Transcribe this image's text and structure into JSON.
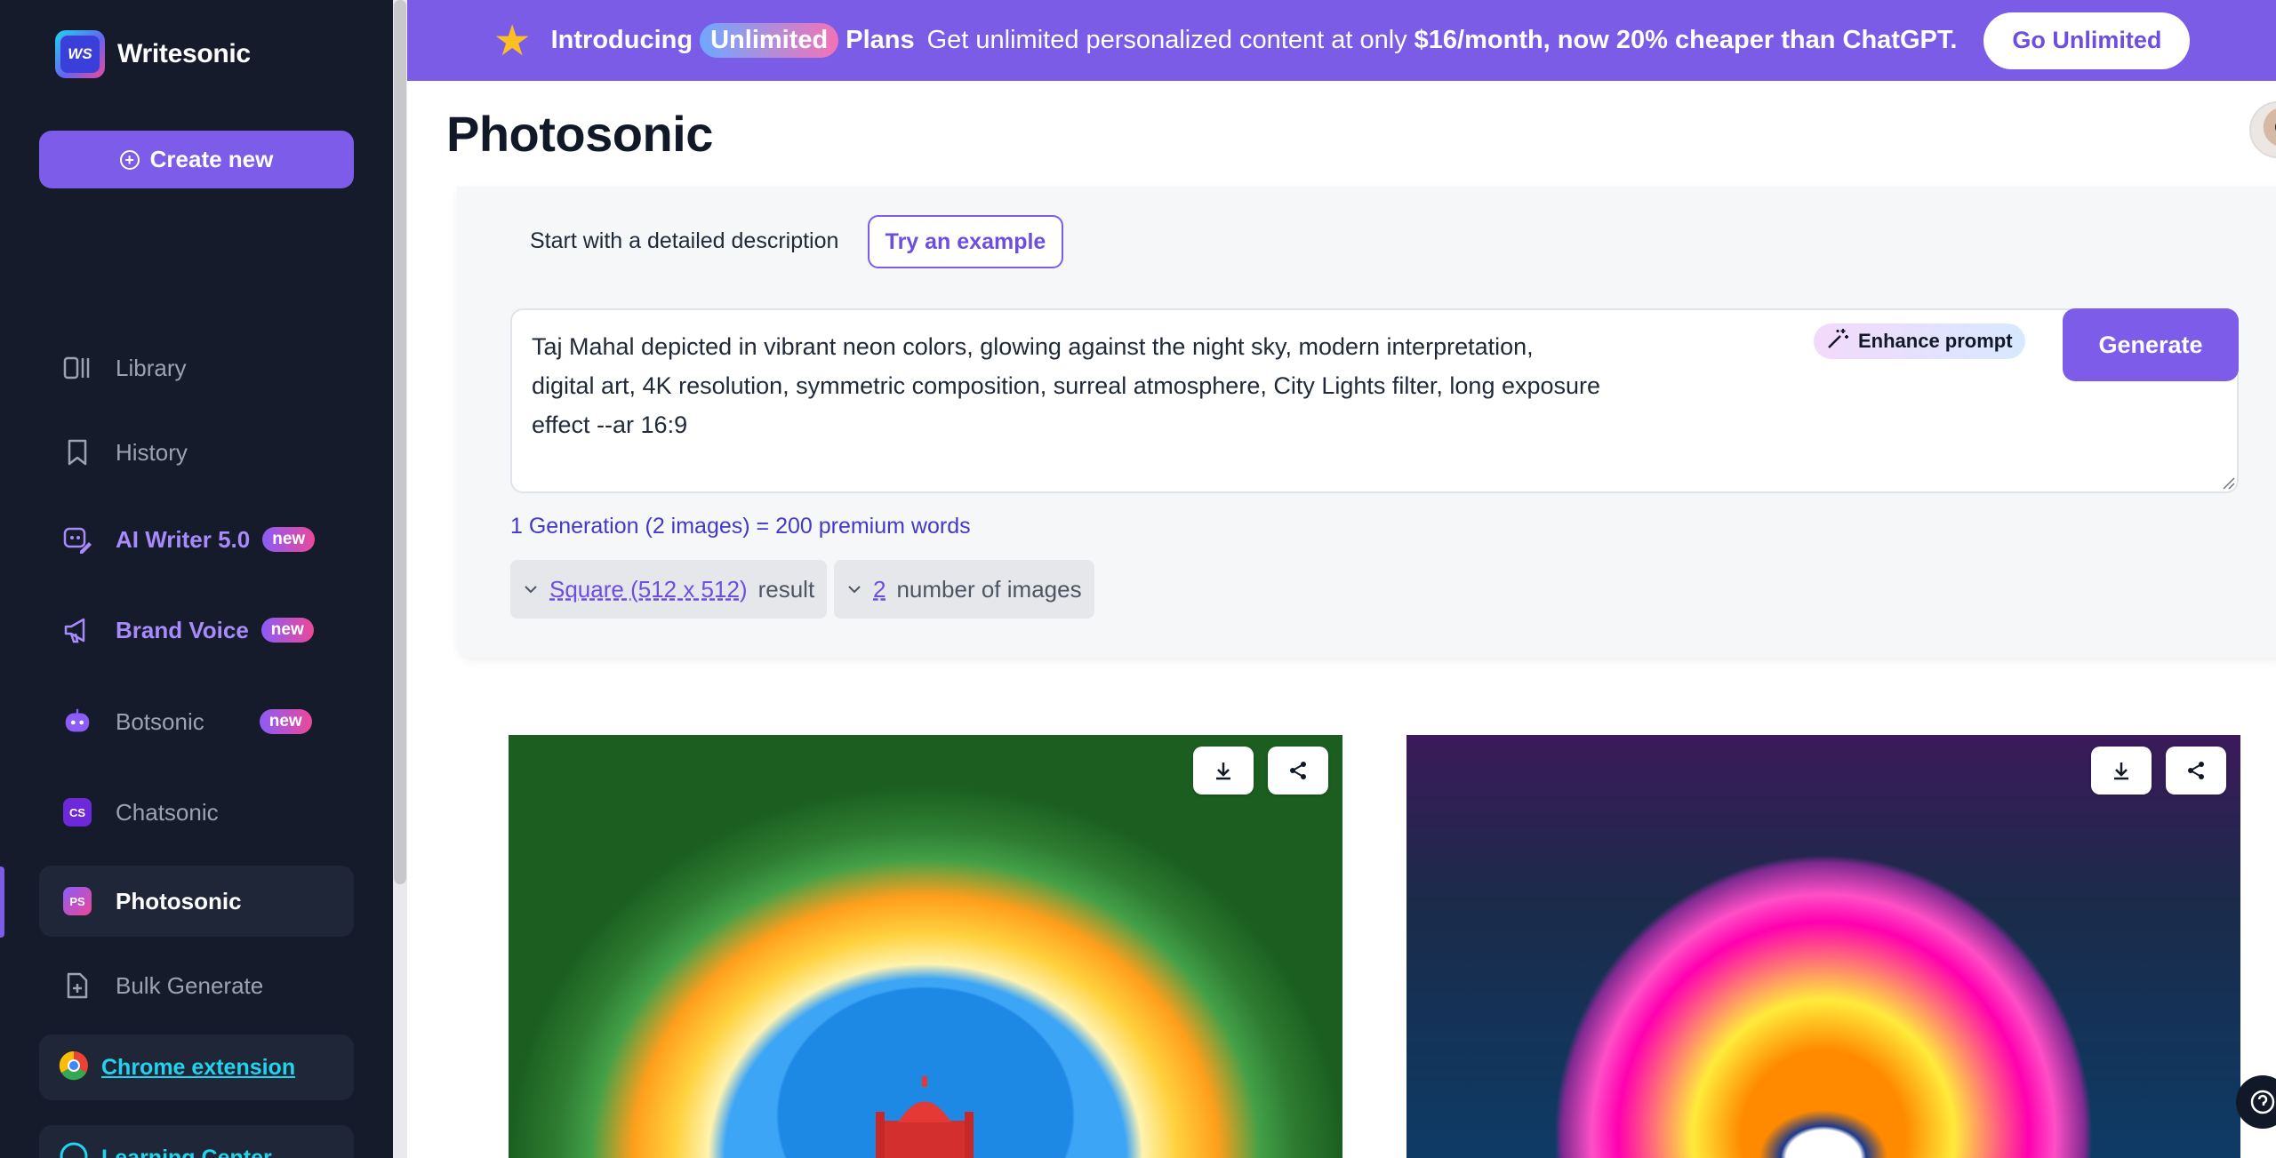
{
  "app": {
    "name": "Writesonic",
    "logo_text": "WS"
  },
  "sidebar": {
    "create_label": "Create new",
    "items": [
      {
        "label": "Library",
        "icon": "library-icon"
      },
      {
        "label": "History",
        "icon": "bookmark-icon"
      },
      {
        "label": "AI Writer 5.0",
        "icon": "ai-writer-icon",
        "badge": "new"
      },
      {
        "label": "Brand Voice",
        "icon": "megaphone-icon",
        "badge": "new"
      },
      {
        "label": "Botsonic",
        "icon": "bot-icon",
        "badge": "new"
      },
      {
        "label": "Chatsonic",
        "icon": "chatsonic-icon",
        "icon_text": "CS"
      },
      {
        "label": "Photosonic",
        "icon": "photosonic-icon",
        "icon_text": "PS",
        "active": true
      },
      {
        "label": "Bulk Generate",
        "icon": "file-plus-icon"
      }
    ],
    "chrome_extension_label": "Chrome extension",
    "learning_center_label": "Learning Center"
  },
  "banner": {
    "intro": "Introducing",
    "unlimited": "Unlimited",
    "plans": "Plans",
    "desc_prefix": "Get unlimited personalized content at only",
    "desc_bold": "$16/month, now 20% cheaper than ChatGPT.",
    "cta_label": "Go Unlimited",
    "accent_color": "#7b5ce6"
  },
  "main": {
    "title": "Photosonic",
    "start_label": "Start with a detailed description",
    "try_example_label": "Try an example",
    "prompt_lines": [
      "Taj Mahal depicted in vibrant neon colors, glowing against the night sky, modern interpretation,",
      "digital art, 4K resolution, symmetric composition, surreal atmosphere, City Lights filter, long exposure",
      "effect --ar 16:9"
    ],
    "enhance_label": "Enhance prompt",
    "generate_label": "Generate",
    "cost_text": "1 Generation (2 images) = 200 premium words",
    "size_option": {
      "value": "Square (512 x 512)",
      "suffix": "result"
    },
    "count_option": {
      "value": "2",
      "suffix": "number of images"
    }
  },
  "colors": {
    "sidebar_bg": "#151b2b",
    "primary": "#7c5ce8",
    "link": "#22d3ee"
  }
}
